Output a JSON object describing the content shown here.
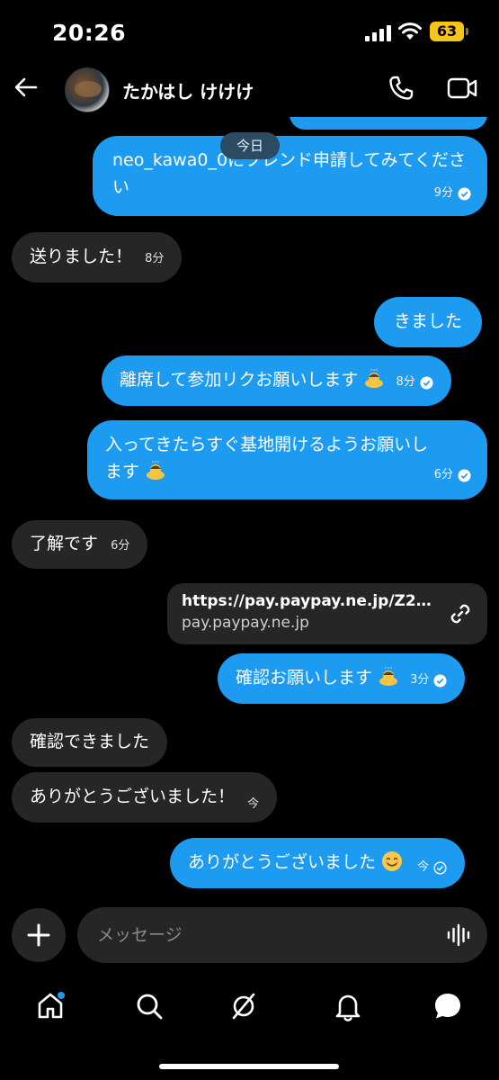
{
  "status_bar": {
    "time": "20:26",
    "battery": "63"
  },
  "header": {
    "contact_name": "たかはし けけけ"
  },
  "messages": {
    "date_label": "今日",
    "m1": {
      "text": "neo_kawa0_0にフレンド申請してみてください",
      "time": "9分"
    },
    "m2": {
      "text": "送りました！",
      "time": "8分"
    },
    "m3": {
      "text": "きました"
    },
    "m4": {
      "text": "離席して参加リクお願いします",
      "time": "8分"
    },
    "m5": {
      "line1": "入ってきたらすぐ基地開けるようお願いし",
      "line2": "ます",
      "time": "6分"
    },
    "m6": {
      "text": "了解です",
      "time": "6分"
    },
    "link": {
      "url": "https://pay.paypay.ne.jp/Z2x...",
      "domain": "pay.paypay.ne.jp"
    },
    "m7": {
      "text": "確認お願いします",
      "time": "3分"
    },
    "m8": {
      "text": "確認できました"
    },
    "m9": {
      "text": "ありがとうございました！",
      "time": "今"
    },
    "m10": {
      "text": "ありがとうございました",
      "time": "今"
    }
  },
  "composer": {
    "placeholder": "メッセージ"
  },
  "colors": {
    "outgoing_bubble": "#1d9bf0",
    "incoming_bubble": "#262626",
    "background": "#000000",
    "battery": "#f5c518"
  }
}
